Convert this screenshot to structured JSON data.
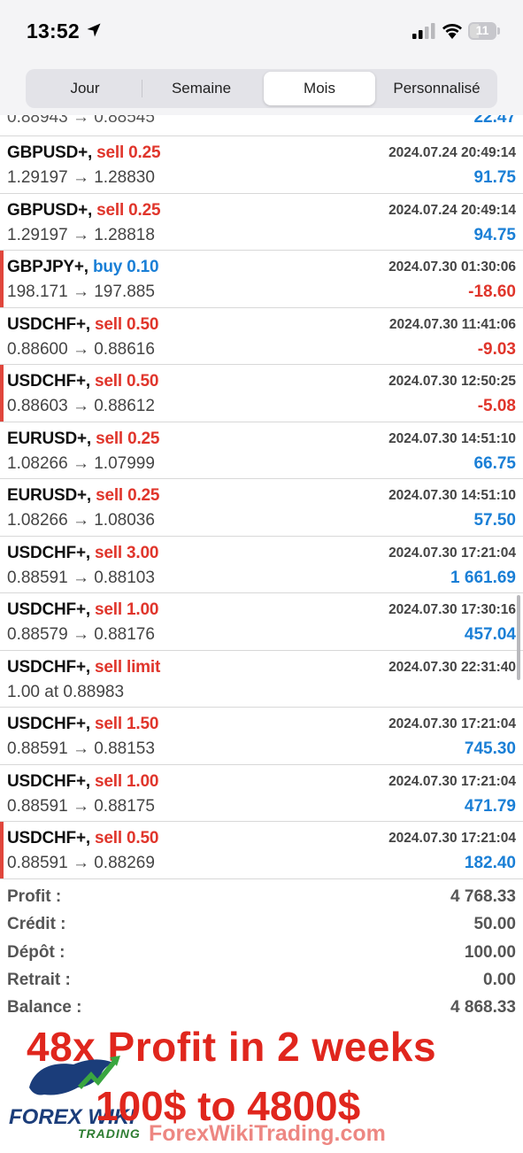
{
  "status_bar": {
    "time": "13:52",
    "battery_level": "11",
    "location_icon": "location-arrow-icon",
    "signal_icon": "cell-signal-icon",
    "wifi_icon": "wifi-icon"
  },
  "segmented_control": {
    "tabs": [
      "Jour",
      "Semaine",
      "Mois",
      "Personnalisé"
    ],
    "selected": "Mois"
  },
  "partial_row": {
    "price": "0.88943 → 0.88545",
    "profit": "22.47"
  },
  "trades": [
    {
      "symbol": "GBPUSD+,",
      "side": "sell 0.25",
      "side_type": "sell",
      "date": "2024.07.24 20:49:14",
      "price": "1.29197 → 1.28830",
      "profit": "91.75",
      "profit_sign": "pos",
      "marker": false
    },
    {
      "symbol": "GBPUSD+,",
      "side": "sell 0.25",
      "side_type": "sell",
      "date": "2024.07.24 20:49:14",
      "price": "1.29197 → 1.28818",
      "profit": "94.75",
      "profit_sign": "pos",
      "marker": false
    },
    {
      "symbol": "GBPJPY+,",
      "side": "buy 0.10",
      "side_type": "buy",
      "date": "2024.07.30 01:30:06",
      "price": "198.171 → 197.885",
      "profit": "-18.60",
      "profit_sign": "neg",
      "marker": true
    },
    {
      "symbol": "USDCHF+,",
      "side": "sell 0.50",
      "side_type": "sell",
      "date": "2024.07.30 11:41:06",
      "price": "0.88600 → 0.88616",
      "profit": "-9.03",
      "profit_sign": "neg",
      "marker": false
    },
    {
      "symbol": "USDCHF+,",
      "side": "sell 0.50",
      "side_type": "sell",
      "date": "2024.07.30 12:50:25",
      "price": "0.88603 → 0.88612",
      "profit": "-5.08",
      "profit_sign": "neg",
      "marker": true
    },
    {
      "symbol": "EURUSD+,",
      "side": "sell 0.25",
      "side_type": "sell",
      "date": "2024.07.30 14:51:10",
      "price": "1.08266 → 1.07999",
      "profit": "66.75",
      "profit_sign": "pos",
      "marker": false
    },
    {
      "symbol": "EURUSD+,",
      "side": "sell 0.25",
      "side_type": "sell",
      "date": "2024.07.30 14:51:10",
      "price": "1.08266 → 1.08036",
      "profit": "57.50",
      "profit_sign": "pos",
      "marker": false
    },
    {
      "symbol": "USDCHF+,",
      "side": "sell 3.00",
      "side_type": "sell",
      "date": "2024.07.30 17:21:04",
      "price": "0.88591 → 0.88103",
      "profit": "1 661.69",
      "profit_sign": "pos",
      "marker": false
    },
    {
      "symbol": "USDCHF+,",
      "side": "sell 1.00",
      "side_type": "sell",
      "date": "2024.07.30 17:30:16",
      "price": "0.88579 → 0.88176",
      "profit": "457.04",
      "profit_sign": "pos",
      "marker": false
    },
    {
      "symbol": "USDCHF+,",
      "side": "sell limit",
      "side_type": "sell",
      "date": "2024.07.30 22:31:40",
      "price": "1.00 at 0.88983",
      "profit": "",
      "profit_sign": "pos",
      "marker": false
    },
    {
      "symbol": "USDCHF+,",
      "side": "sell 1.50",
      "side_type": "sell",
      "date": "2024.07.30 17:21:04",
      "price": "0.88591 → 0.88153",
      "profit": "745.30",
      "profit_sign": "pos",
      "marker": false
    },
    {
      "symbol": "USDCHF+,",
      "side": "sell 1.00",
      "side_type": "sell",
      "date": "2024.07.30 17:21:04",
      "price": "0.88591 → 0.88175",
      "profit": "471.79",
      "profit_sign": "pos",
      "marker": false
    },
    {
      "symbol": "USDCHF+,",
      "side": "sell 0.50",
      "side_type": "sell",
      "date": "2024.07.30 17:21:04",
      "price": "0.88591 → 0.88269",
      "profit": "182.40",
      "profit_sign": "pos",
      "marker": true
    }
  ],
  "summary": [
    {
      "label": "Profit :",
      "value": "4 768.33"
    },
    {
      "label": "Crédit :",
      "value": "50.00"
    },
    {
      "label": "Dépôt :",
      "value": "100.00"
    },
    {
      "label": "Retrait :",
      "value": "0.00"
    },
    {
      "label": "Balance :",
      "value": "4 868.33"
    }
  ],
  "overlay": {
    "headline": "48x Profit in 2 weeks",
    "subheadline": "100$ to 4800$",
    "watermark": "ForexWikiTrading.com",
    "logo_text": "FOREX WIKI",
    "logo_sub": "TRADING"
  },
  "colors": {
    "sell": "#e0352b",
    "buy": "#1a7fd6",
    "profit_positive": "#1a7fd6",
    "profit_negative": "#e0352b",
    "promo": "#e0261d"
  }
}
